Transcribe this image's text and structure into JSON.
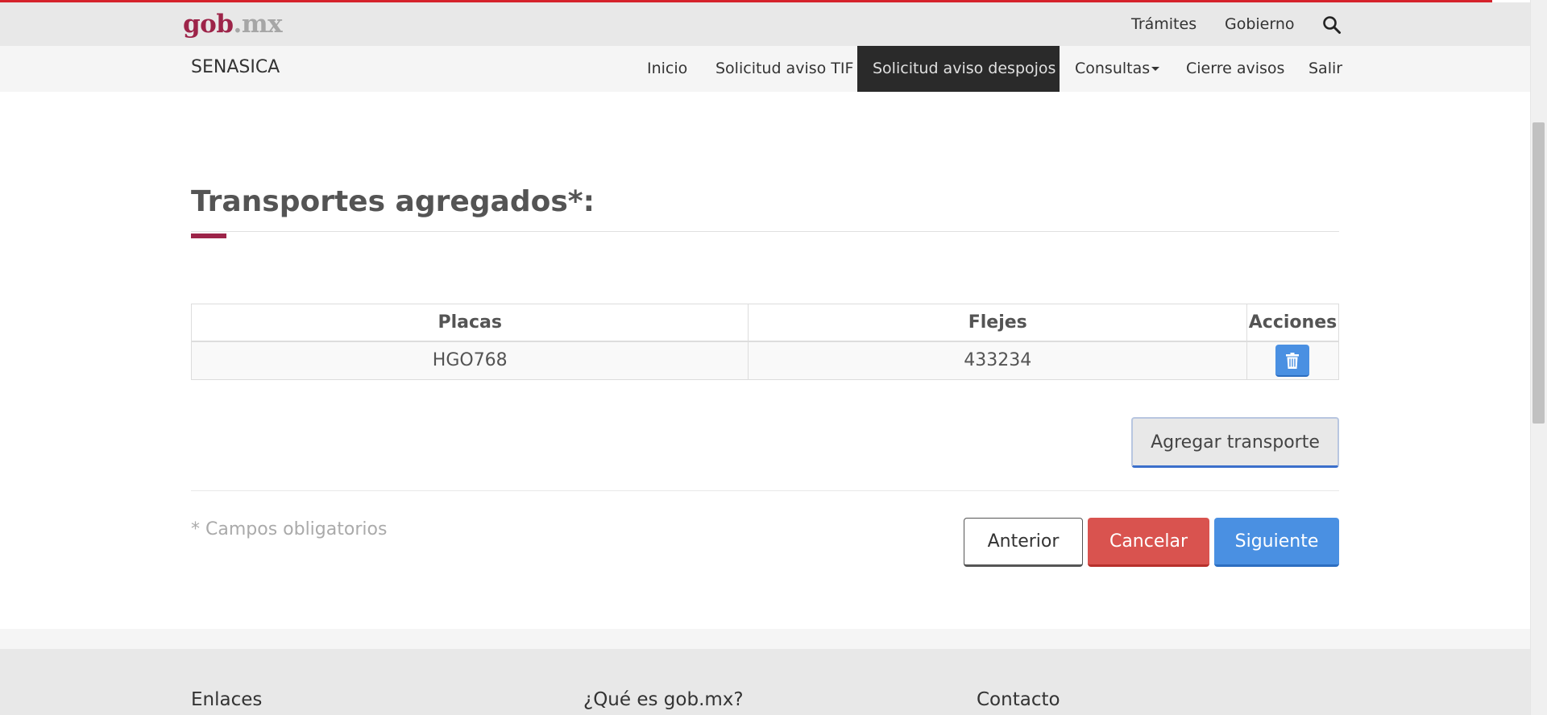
{
  "gov_bar": {
    "logo_gob": "gob",
    "logo_mx": ".mx",
    "links": [
      "Trámites",
      "Gobierno"
    ],
    "search_icon": "search-icon"
  },
  "nav": {
    "brand": "SENASICA",
    "items": [
      "Inicio",
      "Solicitud aviso TIF",
      "Solicitud aviso despojos",
      "Consultas",
      "Cierre avisos",
      "Salir"
    ],
    "active": "Solicitud aviso despojos"
  },
  "main": {
    "title": "Transportes agregados*:",
    "table": {
      "headers": [
        "Placas",
        "Flejes",
        "Acciones"
      ],
      "rows": [
        {
          "placas": "HGO768",
          "flejes": "433234",
          "action_icon": "trash-icon"
        }
      ]
    },
    "add_button": "Agregar transporte",
    "required_note": "* Campos obligatorios",
    "buttons": {
      "anterior": "Anterior",
      "cancelar": "Cancelar",
      "siguiente": "Siguiente"
    }
  },
  "footer": {
    "headings": [
      "Enlaces",
      "¿Qué es gob.mx?",
      "Contacto"
    ]
  },
  "colors": {
    "brand": "#9d2449",
    "primary": "#4a90e2",
    "danger": "#d9534f",
    "nav_active": "#2a2a2a"
  }
}
